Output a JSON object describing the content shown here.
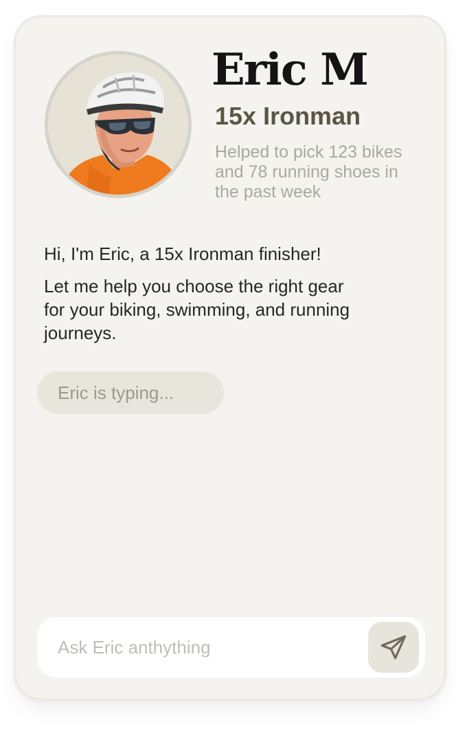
{
  "profile": {
    "name": "Eric M",
    "subtitle": "15x Ironman",
    "stats_lines": [
      "Helped to pick 123 bikes",
      "and 78 running  shoes in",
      "the past week"
    ],
    "avatar_icon": "person-photo"
  },
  "chat": {
    "messages": [
      {
        "lines": [
          "Hi, I'm Eric, a 15x Ironman finisher!"
        ]
      },
      {
        "lines": [
          "Let me help you choose the right gear",
          "for your biking, swimming, and running",
          "journeys."
        ]
      }
    ],
    "typing_indicator": "Eric is typing..."
  },
  "composer": {
    "placeholder": "Ask Eric anthything",
    "value": "",
    "send_icon": "paper-plane-icon"
  },
  "colors": {
    "card_background": "#f4f3ef",
    "typing_bubble": "#e8e5dd",
    "send_button": "#e7e4dc",
    "subtitle": "#5b5545",
    "stats": "#aaa8a1"
  }
}
